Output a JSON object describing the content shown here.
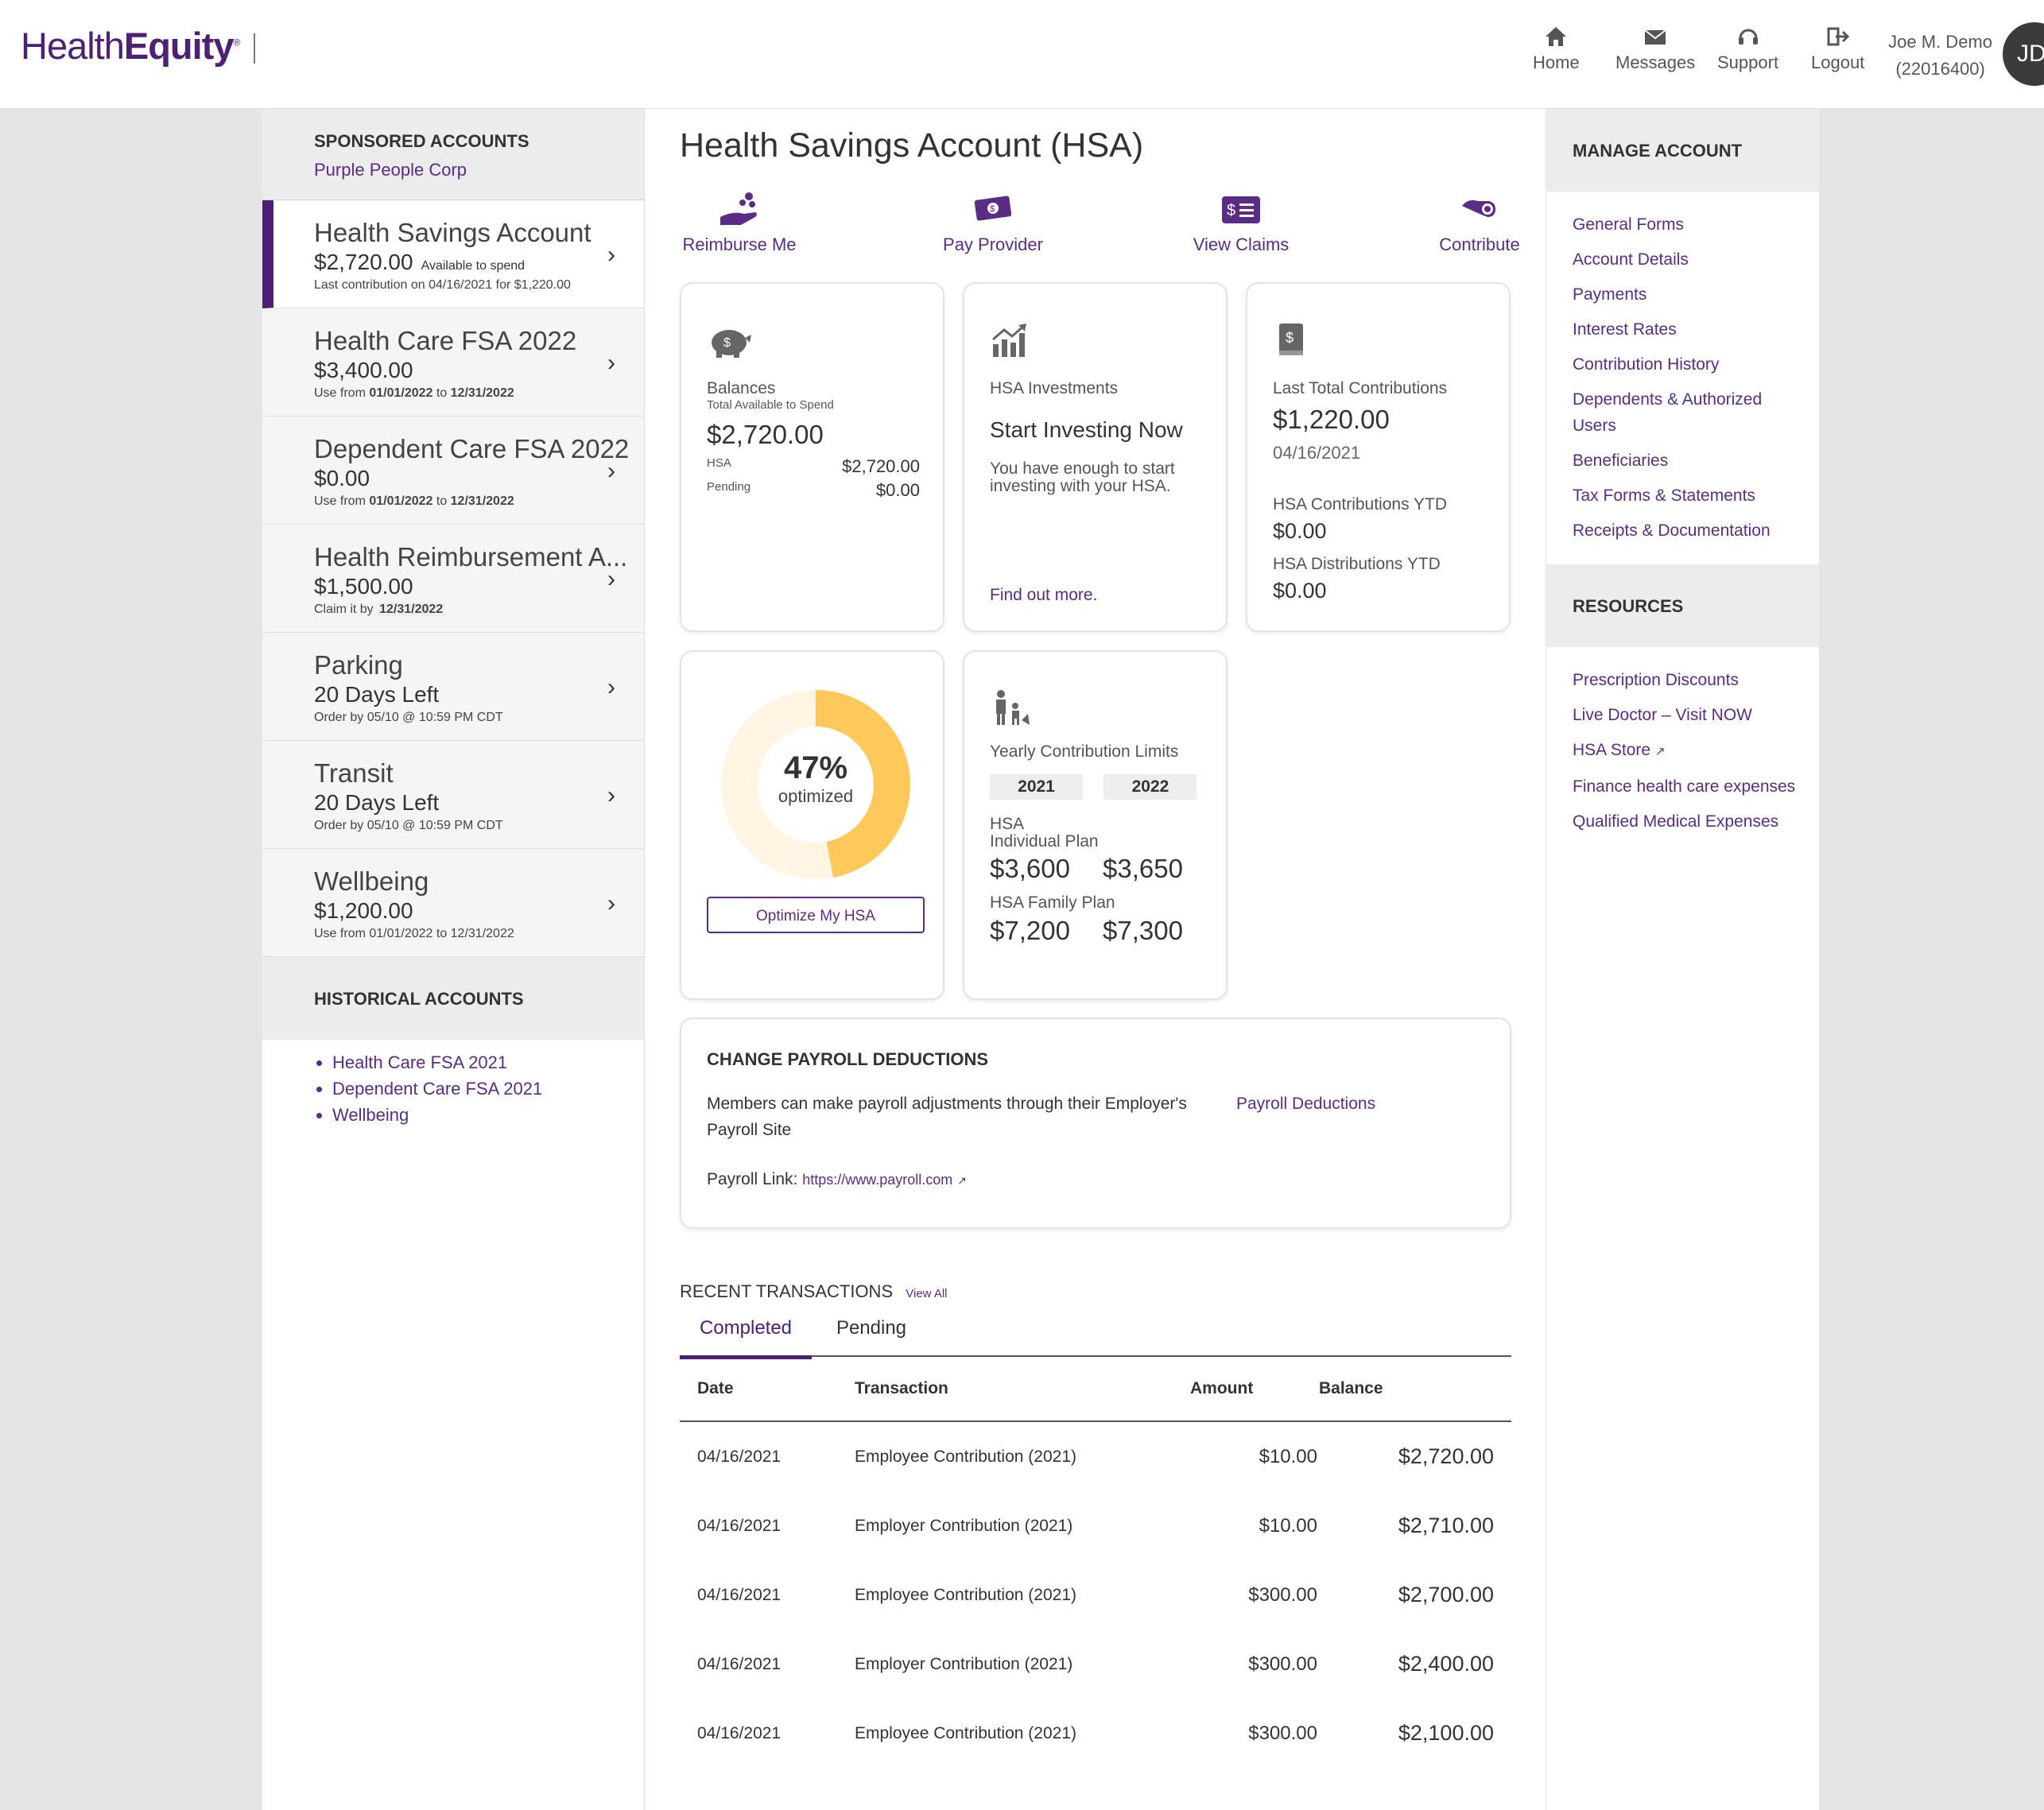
{
  "header": {
    "logo_health": "Health",
    "logo_equity": "Equity",
    "nav": [
      {
        "label": "Home",
        "icon": "home-icon"
      },
      {
        "label": "Messages",
        "icon": "envelope-icon"
      },
      {
        "label": "Support",
        "icon": "headset-icon"
      },
      {
        "label": "Logout",
        "icon": "logout-icon"
      }
    ],
    "user_name": "Joe M. Demo",
    "user_id": "(22016400)",
    "avatar_initials": "JD"
  },
  "sidebar": {
    "sponsored_title": "SPONSORED ACCOUNTS",
    "employer": "Purple People Corp",
    "accounts": [
      {
        "name": "Health Savings Account",
        "amount": "$2,720.00",
        "amount_note": "Available to spend",
        "note": "Last contribution on 04/16/2021 for $1,220.00"
      },
      {
        "name": "Health Care FSA 2022",
        "amount": "$3,400.00",
        "note_prefix": "Use from ",
        "note_from": "01/01/2022",
        "note_mid": " to ",
        "note_to": "12/31/2022"
      },
      {
        "name": "Dependent Care FSA 2022",
        "amount": "$0.00",
        "note_prefix": "Use from ",
        "note_from": "01/01/2022",
        "note_mid": " to ",
        "note_to": "12/31/2022"
      },
      {
        "name": "Health Reimbursement A...",
        "amount": "$1,500.00",
        "note_prefix": "Claim it by ",
        "note_to": "12/31/2022"
      },
      {
        "name": "Parking",
        "amount": "20 Days Left",
        "note": "Order by 05/10 @ 10:59 PM CDT"
      },
      {
        "name": "Transit",
        "amount": "20 Days Left",
        "note": "Order by 05/10 @ 10:59 PM CDT"
      },
      {
        "name": "Wellbeing",
        "amount": "$1,200.00",
        "note": "Use from 01/01/2022 to 12/31/2022"
      }
    ],
    "historical_title": "HISTORICAL ACCOUNTS",
    "historical": [
      "Health Care FSA 2021",
      "Dependent Care FSA 2021",
      "Wellbeing"
    ]
  },
  "main": {
    "title": "Health Savings Account (HSA)",
    "actions": [
      {
        "label": "Reimburse Me",
        "icon": "reimburse-icon"
      },
      {
        "label": "Pay Provider",
        "icon": "pay-provider-icon"
      },
      {
        "label": "View Claims",
        "icon": "claims-icon"
      },
      {
        "label": "Contribute",
        "icon": "contribute-icon"
      }
    ],
    "balances": {
      "label": "Balances",
      "sub": "Total Available to Spend",
      "total": "$2,720.00",
      "hsa_label": "HSA",
      "hsa_value": "$2,720.00",
      "pending_label": "Pending",
      "pending_value": "$0.00"
    },
    "investments": {
      "label": "HSA Investments",
      "heading": "Start Investing Now",
      "text": "You have enough to start investing with your HSA.",
      "link": "Find out more."
    },
    "contributions": {
      "label": "Last Total Contributions",
      "amount": "$1,220.00",
      "date": "04/16/2021",
      "ytd_label": "HSA Contributions YTD",
      "ytd_value": "$0.00",
      "dist_label": "HSA Distributions YTD",
      "dist_value": "$0.00"
    },
    "optimize": {
      "percent_value": 47,
      "percent_text": "47%",
      "sub": "optimized",
      "button": "Optimize My HSA",
      "colors": {
        "fill": "#fcc95a",
        "track": "#fef5e3"
      }
    },
    "limits": {
      "label": "Yearly Contribution Limits",
      "years": [
        "2021",
        "2022"
      ],
      "individual_label_1": "HSA",
      "individual_label_2": "Individual Plan",
      "individual": [
        "$3,600",
        "$3,650"
      ],
      "family_label": "HSA Family Plan",
      "family": [
        "$7,200",
        "$7,300"
      ]
    },
    "payroll": {
      "title": "CHANGE PAYROLL DEDUCTIONS",
      "text": "Members can make payroll adjustments through their Employer's Payroll Site",
      "link": "Payroll Deductions",
      "payroll_link_label": "Payroll Link:",
      "payroll_url": "https://www.payroll.com"
    },
    "transactions": {
      "title": "RECENT TRANSACTIONS",
      "view_all": "View All",
      "tabs": [
        "Completed",
        "Pending"
      ],
      "columns": [
        "Date",
        "Transaction",
        "Amount",
        "Balance"
      ],
      "rows": [
        {
          "date": "04/16/2021",
          "desc": "Employee Contribution (2021)",
          "amount": "$10.00",
          "balance": "$2,720.00"
        },
        {
          "date": "04/16/2021",
          "desc": "Employer Contribution (2021)",
          "amount": "$10.00",
          "balance": "$2,710.00"
        },
        {
          "date": "04/16/2021",
          "desc": "Employee Contribution (2021)",
          "amount": "$300.00",
          "balance": "$2,700.00"
        },
        {
          "date": "04/16/2021",
          "desc": "Employer Contribution (2021)",
          "amount": "$300.00",
          "balance": "$2,400.00"
        },
        {
          "date": "04/16/2021",
          "desc": "Employee Contribution (2021)",
          "amount": "$300.00",
          "balance": "$2,100.00"
        }
      ]
    }
  },
  "right_panel": {
    "manage_title": "MANAGE ACCOUNT",
    "manage_links": [
      "General Forms",
      "Account Details",
      "Payments",
      "Interest Rates",
      "Contribution History",
      "Dependents & Authorized Users",
      "Beneficiaries",
      "Tax Forms & Statements",
      "Receipts & Documentation"
    ],
    "resources_title": "RESOURCES",
    "resource_links": [
      "Prescription Discounts",
      "Live Doctor – Visit NOW",
      "HSA Store",
      "Finance health care expenses",
      "Qualified Medical Expenses"
    ]
  },
  "colors": {
    "brand": "#4b2075",
    "link": "#5a2c86",
    "accent": "#fcc95a"
  }
}
